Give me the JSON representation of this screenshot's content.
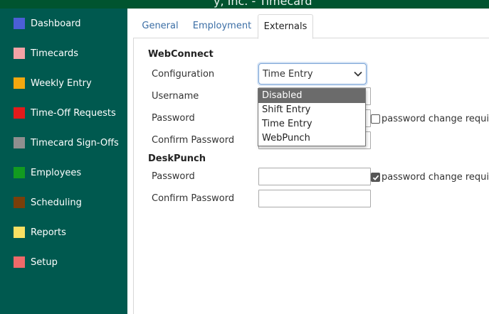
{
  "header": {
    "title_fragment": "y, Inc. - Timecard"
  },
  "sidebar": {
    "items": [
      {
        "label": "Dashboard",
        "color": "#4b5fd6"
      },
      {
        "label": "Timecards",
        "color": "#f3a3a6"
      },
      {
        "label": "Weekly Entry",
        "color": "#f2a80f"
      },
      {
        "label": "Time-Off Requests",
        "color": "#e31b1b"
      },
      {
        "label": "Timecard Sign-Offs",
        "color": "#8f8f8f"
      },
      {
        "label": "Employees",
        "color": "#129b20"
      },
      {
        "label": "Scheduling",
        "color": "#7a3f0a"
      },
      {
        "label": "Reports",
        "color": "#f9e063"
      },
      {
        "label": "Setup",
        "color": "#f06a6a"
      }
    ]
  },
  "tabs": [
    {
      "label": "General",
      "active": false
    },
    {
      "label": "Employment",
      "active": false
    },
    {
      "label": "Externals",
      "active": true
    }
  ],
  "webconnect": {
    "title": "WebConnect",
    "configuration_label": "Configuration",
    "configuration_value": "Time Entry",
    "username_label": "Username",
    "username_value": "",
    "password_label": "Password",
    "password_value": "",
    "password_change_label": "password change required",
    "password_change_checked": false,
    "confirm_password_label": "Confirm Password",
    "confirm_password_value": ""
  },
  "dropdown": {
    "options": [
      "Disabled",
      "Shift Entry",
      "Time Entry",
      "WebPunch"
    ],
    "highlighted": "Disabled"
  },
  "deskpunch": {
    "title": "DeskPunch",
    "password_label": "Password",
    "password_value": "",
    "password_change_label": "password change required",
    "password_change_checked": true,
    "confirm_password_label": "Confirm Password",
    "confirm_password_value": ""
  }
}
